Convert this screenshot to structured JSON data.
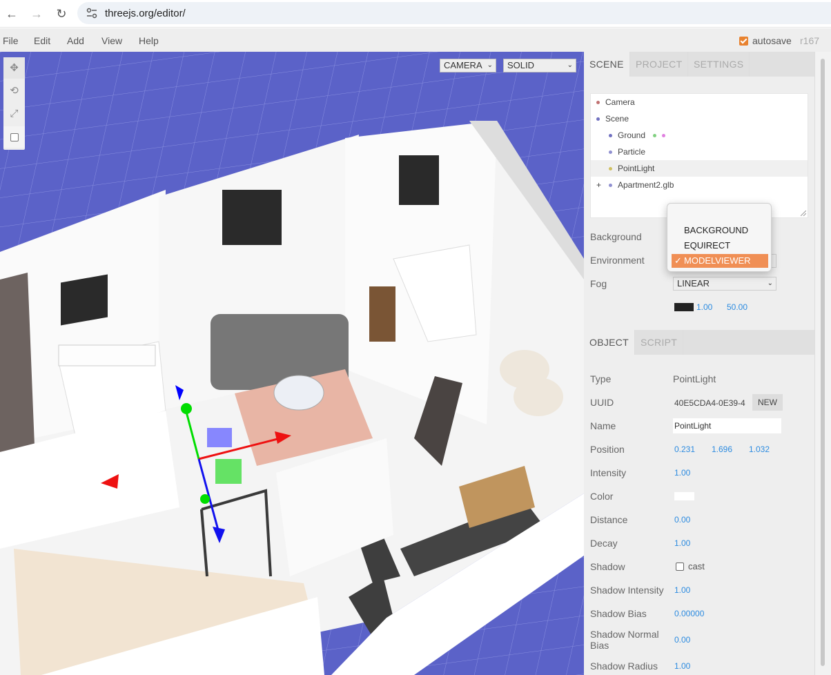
{
  "browser": {
    "url": "threejs.org/editor/"
  },
  "menubar": {
    "items": [
      "File",
      "Edit",
      "Add",
      "View",
      "Help"
    ],
    "autosave_label": "autosave",
    "version": "r167"
  },
  "viewport": {
    "camera_select": "CAMERA",
    "shading_select": "SOLID"
  },
  "sidebar": {
    "tabs": [
      "SCENE",
      "PROJECT",
      "SETTINGS"
    ],
    "outliner": [
      {
        "label": "Camera",
        "color": "#c07070"
      },
      {
        "label": "Scene",
        "color": "#7070c0"
      },
      {
        "label": "Ground",
        "color": "#7070c0"
      },
      {
        "label": "Particle",
        "color": "#9090d0"
      },
      {
        "label": "PointLight",
        "color": "#d0c060"
      },
      {
        "label": "Apartment2.glb",
        "color": "#9090d0",
        "expander": "+"
      }
    ],
    "background_label": "Background",
    "environment_label": "Environment",
    "fog_label": "Fog",
    "fog_select": "LINEAR",
    "fog_near": "1.00",
    "fog_far": "50.00",
    "environment_options": [
      "BACKGROUND",
      "EQUIRECT",
      "MODELVIEWER"
    ],
    "environment_selected": "MODELVIEWER",
    "check_mark": "✓",
    "object_tabs": [
      "OBJECT",
      "SCRIPT"
    ],
    "object": {
      "type_label": "Type",
      "type_value": "PointLight",
      "uuid_label": "UUID",
      "uuid_value": "40E5CDA4-0E39-4",
      "new_button": "NEW",
      "name_label": "Name",
      "name_value": "PointLight",
      "position_label": "Position",
      "position": [
        "0.231",
        "1.696",
        "1.032"
      ],
      "intensity_label": "Intensity",
      "intensity": "1.00",
      "color_label": "Color",
      "distance_label": "Distance",
      "distance": "0.00",
      "decay_label": "Decay",
      "decay": "1.00",
      "shadow_label": "Shadow",
      "shadow_cast": "cast",
      "shadow_intensity_label": "Shadow Intensity",
      "shadow_intensity": "1.00",
      "shadow_bias_label": "Shadow Bias",
      "shadow_bias": "0.00000",
      "shadow_normal_bias_label_1": "Shadow Normal",
      "shadow_normal_bias_label_2": "Bias",
      "shadow_normal_bias": "0.00",
      "shadow_radius_label": "Shadow Radius",
      "shadow_radius": "1.00"
    }
  },
  "colors": {
    "accent": "#e8822f",
    "viewport_bg": "#5b62c8",
    "link_value": "#2c8be0"
  }
}
